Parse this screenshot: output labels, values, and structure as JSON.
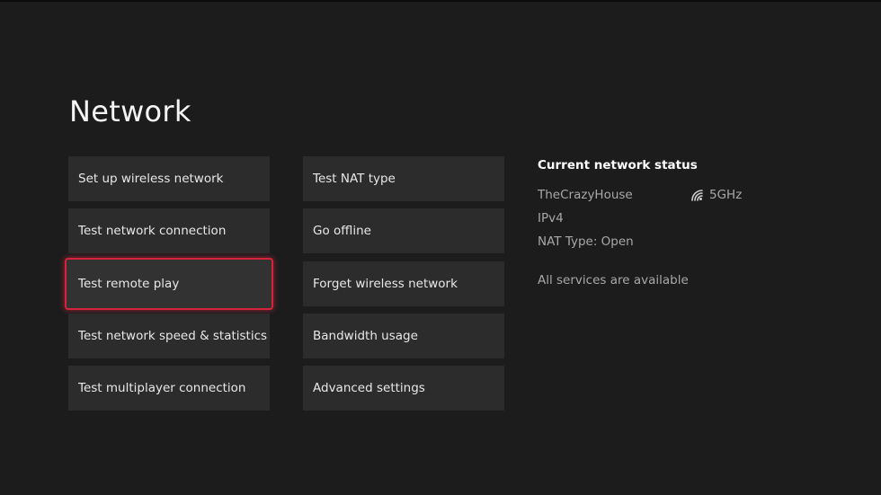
{
  "page": {
    "title": "Network"
  },
  "menu": {
    "column1": [
      {
        "label": "Set up wireless network"
      },
      {
        "label": "Test network connection"
      },
      {
        "label": "Test remote play"
      },
      {
        "label": "Test network speed & statistics"
      },
      {
        "label": "Test multiplayer connection"
      }
    ],
    "column2": [
      {
        "label": "Test NAT type"
      },
      {
        "label": "Go offline"
      },
      {
        "label": "Forget wireless network"
      },
      {
        "label": "Bandwidth usage"
      },
      {
        "label": "Advanced settings"
      }
    ],
    "focused_item": "Test remote play"
  },
  "status": {
    "heading": "Current network status",
    "network_name": "TheCrazyHouse",
    "band": "5GHz",
    "band_icon": "wifi-signal-icon",
    "ip_version": "IPv4",
    "nat_type": "NAT Type: Open",
    "services": "All services are available"
  },
  "colors": {
    "background": "#1c1c1c",
    "tile": "#2c2c2c",
    "focus_border": "#d3243b",
    "muted_text": "#a8a8a8"
  }
}
